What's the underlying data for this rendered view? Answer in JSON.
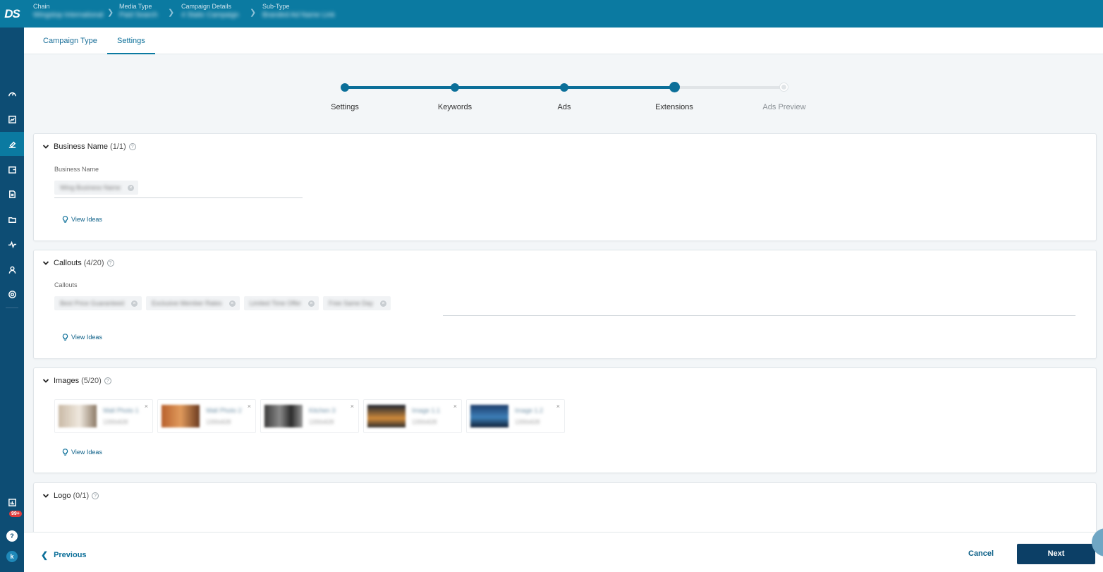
{
  "app": {
    "logo": "DS"
  },
  "breadcrumb": [
    {
      "label": "Chain",
      "value": "Wingstop International"
    },
    {
      "label": "Media Type",
      "value": "Paid Search"
    },
    {
      "label": "Campaign Details",
      "value": "4 Static Campaign"
    },
    {
      "label": "Sub-Type",
      "value": "Branded Ad Name Link"
    }
  ],
  "tabs": [
    {
      "label": "Campaign Type",
      "active": false
    },
    {
      "label": "Settings",
      "active": true
    }
  ],
  "stepper": {
    "steps": [
      {
        "label": "Settings",
        "state": "done"
      },
      {
        "label": "Keywords",
        "state": "done"
      },
      {
        "label": "Ads",
        "state": "done"
      },
      {
        "label": "Extensions",
        "state": "current"
      },
      {
        "label": "Ads Preview",
        "state": "upcoming"
      }
    ]
  },
  "sections": {
    "business_name": {
      "title": "Business Name",
      "count": "(1/1)",
      "field_label": "Business Name",
      "chips": [
        "Wing Business Name"
      ],
      "view_ideas": "View Ideas"
    },
    "callouts": {
      "title": "Callouts",
      "count": "(4/20)",
      "field_label": "Callouts",
      "chips": [
        "Best Price Guaranteed",
        "Exclusive Member Rates",
        "Limited Time Offer",
        "Free Same Day"
      ],
      "view_ideas": "View Ideas"
    },
    "images": {
      "title": "Images",
      "count": "(5/20)",
      "tiles": [
        {
          "name": "Wall Photo 1",
          "dims": "1200x628"
        },
        {
          "name": "Wall Photo 2",
          "dims": "1200x628"
        },
        {
          "name": "Kitchen 3",
          "dims": "1200x628"
        },
        {
          "name": "Image 1.1",
          "dims": "1200x628"
        },
        {
          "name": "Image 1.2",
          "dims": "1200x628"
        }
      ],
      "view_ideas": "View Ideas"
    },
    "logo": {
      "title": "Logo",
      "count": "(0/1)"
    }
  },
  "footer": {
    "previous": "Previous",
    "cancel": "Cancel",
    "next": "Next"
  },
  "notifications": {
    "badge": "99+"
  },
  "user": {
    "initial": "k"
  },
  "colors": {
    "accent": "#0b7aa1",
    "rail": "#0d4d74",
    "primary_button": "#0c3f66"
  },
  "icons": [
    "dashboard-icon",
    "report-icon",
    "campaign-icon",
    "wallet-icon",
    "document-icon",
    "folder-icon",
    "activity-icon",
    "user-icon",
    "settings-icon",
    "chart-icon",
    "bell-icon",
    "help-icon"
  ]
}
